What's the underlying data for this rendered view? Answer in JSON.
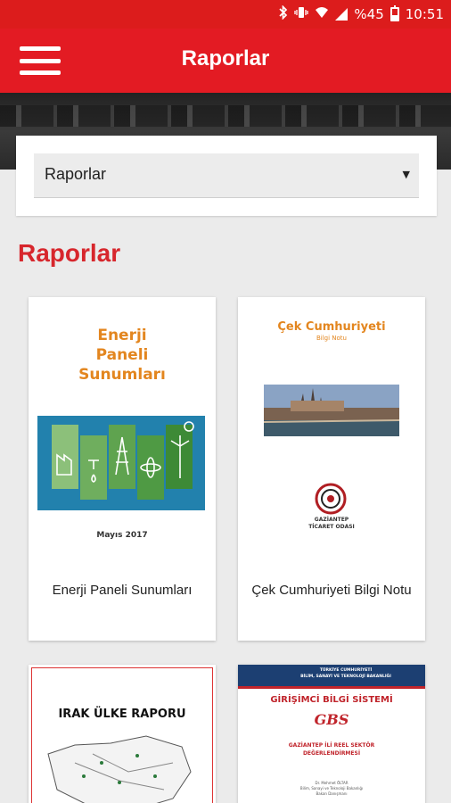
{
  "status_bar": {
    "battery": "%45",
    "time": "10:51",
    "icons": [
      "bluetooth-icon",
      "vibrate-icon",
      "wifi-icon",
      "signal-icon",
      "battery-icon"
    ]
  },
  "app_bar": {
    "title": "Raporlar",
    "menu_icon": "hamburger-menu-icon"
  },
  "filter": {
    "selected": "Raporlar"
  },
  "section_title": "Raporlar",
  "reports": [
    {
      "caption": "Enerji Paneli Sunumları",
      "cover_title_lines": [
        "Enerji",
        "Paneli",
        "Sunumları"
      ],
      "cover_date": "Mayıs 2017"
    },
    {
      "caption": "Çek Cumhuriyeti Bilgi Notu",
      "cover_title": "Çek Cumhuriyeti",
      "cover_subtitle": "Bilgi Notu",
      "cover_logo_text": [
        "GAZİANTEP",
        "TİCARET ODASI"
      ]
    },
    {
      "cover_title": "IRAK ÜLKE RAPORU"
    },
    {
      "cover_header": [
        "TÜRKİYE CUMHURİYETİ",
        "BİLİM, SANAYİ VE TEKNOLOJİ BAKANLIĞI"
      ],
      "cover_title": "GİRİŞİMCİ BİLGİ SİSTEMİ",
      "cover_logo": "GBS",
      "cover_subtitle": [
        "GAZİANTEP İLİ REEL SEKTÖR",
        "DEĞERLENDİRMESİ"
      ],
      "cover_author": [
        "Dr. Mehmet ÖLTAR",
        "Bilim, Sanayi ve Teknoloji Bakanlığı",
        "Bakan Danışmanı"
      ]
    }
  ],
  "colors": {
    "brand_red": "#e31b23",
    "section_red": "#d7262c",
    "cover_orange": "#e3861f"
  }
}
